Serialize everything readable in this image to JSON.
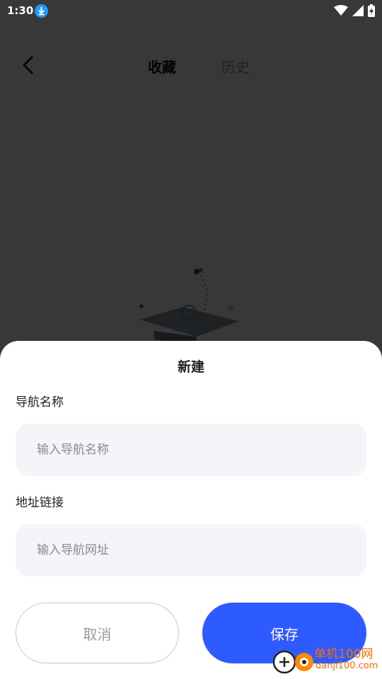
{
  "status_bar": {
    "time": "1:30"
  },
  "header": {
    "tabs": [
      {
        "label": "收藏",
        "active": true
      },
      {
        "label": "历史",
        "active": false
      }
    ]
  },
  "dialog": {
    "title": "新建",
    "name_label": "导航名称",
    "name_placeholder": "输入导航名称",
    "name_value": "",
    "url_label": "地址链接",
    "url_placeholder": "输入导航网址",
    "url_value": "",
    "cancel_label": "取消",
    "save_label": "保存"
  },
  "watermark": {
    "line1": "单机100网",
    "line2": "danji100.com"
  },
  "colors": {
    "accent": "#2e5bff",
    "scrim": "#000000c7",
    "field_bg": "#f4f5f8"
  }
}
